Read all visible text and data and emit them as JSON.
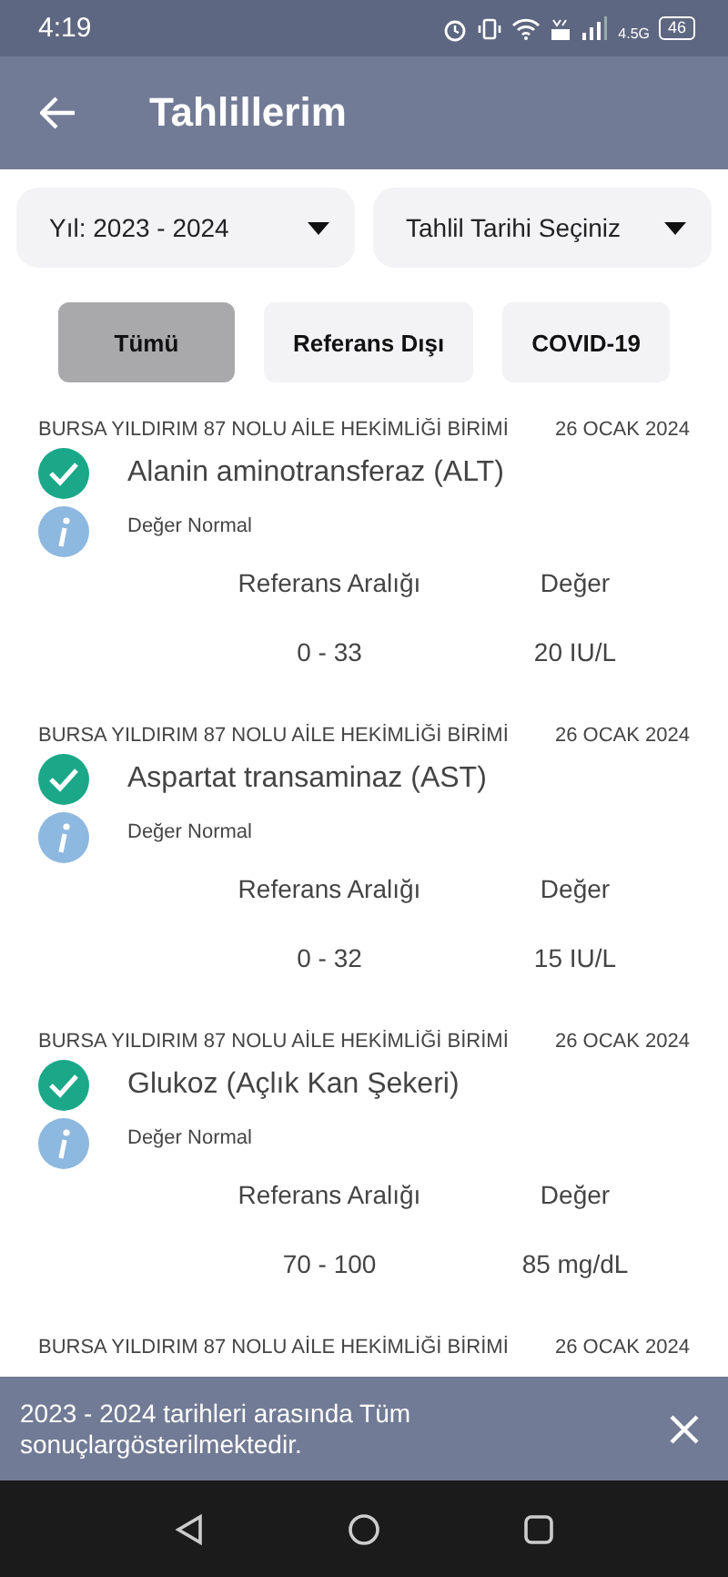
{
  "status_bar": {
    "time": "4:19",
    "network": "4.5G",
    "battery": "46"
  },
  "app_bar": {
    "title": "Tahlillerim"
  },
  "filters": [
    {
      "label": "Yıl: 2023 - 2024"
    },
    {
      "label": "Tahlil Tarihi Seçiniz"
    }
  ],
  "chips": [
    {
      "label": "Tümü",
      "selected": true
    },
    {
      "label": "Referans Dışı",
      "selected": false
    },
    {
      "label": "COVID-19",
      "selected": false
    }
  ],
  "results": [
    {
      "institution": "BURSA YILDIRIM 87 NOLU AİLE HEKİMLİĞİ BİRİMİ",
      "date": "26 OCAK 2024",
      "test": "Alanin aminotransferaz (ALT)",
      "kind": "check",
      "note": "Değer Normal",
      "range_label": "Referans Aralığı",
      "value_label": "Değer",
      "range": "0 - 33",
      "value": "20 IU/L"
    },
    {
      "institution": "BURSA YILDIRIM 87 NOLU AİLE HEKİMLİĞİ BİRİMİ",
      "date": "26 OCAK 2024",
      "test": "Aspartat transaminaz (AST)",
      "kind": "check",
      "note": "Değer Normal",
      "range_label": "Referans Aralığı",
      "value_label": "Değer",
      "range": "0 - 32",
      "value": "15 IU/L"
    },
    {
      "institution": "BURSA YILDIRIM 87 NOLU AİLE HEKİMLİĞİ BİRİMİ",
      "date": "26 OCAK 2024",
      "test": "Glukoz (Açlık Kan Şekeri)",
      "kind": "check",
      "note": "Değer Normal",
      "range_label": "Referans Aralığı",
      "value_label": "Değer",
      "range": "70 - 100",
      "value": "85 mg/dL"
    },
    {
      "institution": "BURSA YILDIRIM 87 NOLU AİLE HEKİMLİĞİ BİRİMİ",
      "date": "26 OCAK 2024"
    }
  ],
  "snackbar": {
    "message": "2023 - 2024 tarihleri arasında Tüm sonuçlargösterilmektedir."
  }
}
